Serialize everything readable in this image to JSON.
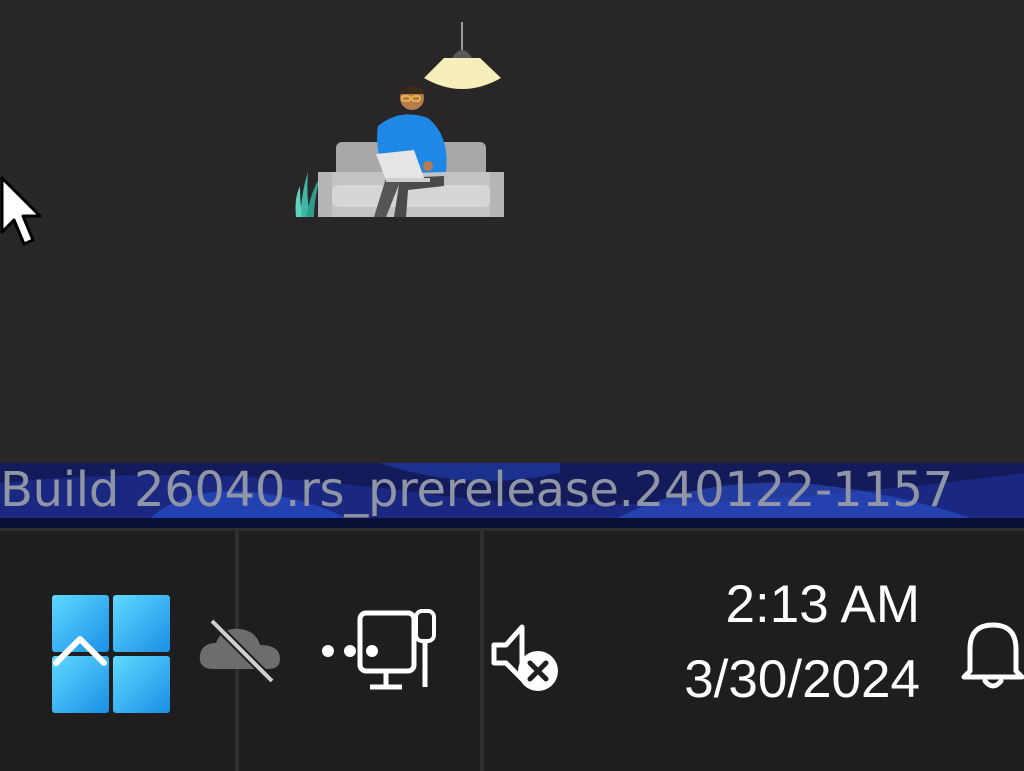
{
  "window": {
    "illustration": "person-on-sofa-with-laptop",
    "background": "#282626"
  },
  "desktop": {
    "build_watermark": "Build 26040.rs_prerelease.240122-1157"
  },
  "taskbar": {
    "start_icon": "windows-logo-icon",
    "tray_icons": [
      "chevron-up-icon",
      "onedrive-offline-icon",
      "network-disconnected-icon",
      "volume-muted-icon"
    ],
    "clock": {
      "time": "2:13 AM",
      "date": "3/30/2024"
    },
    "notification_icon": "bell-icon",
    "accent": "#35b5f0"
  }
}
